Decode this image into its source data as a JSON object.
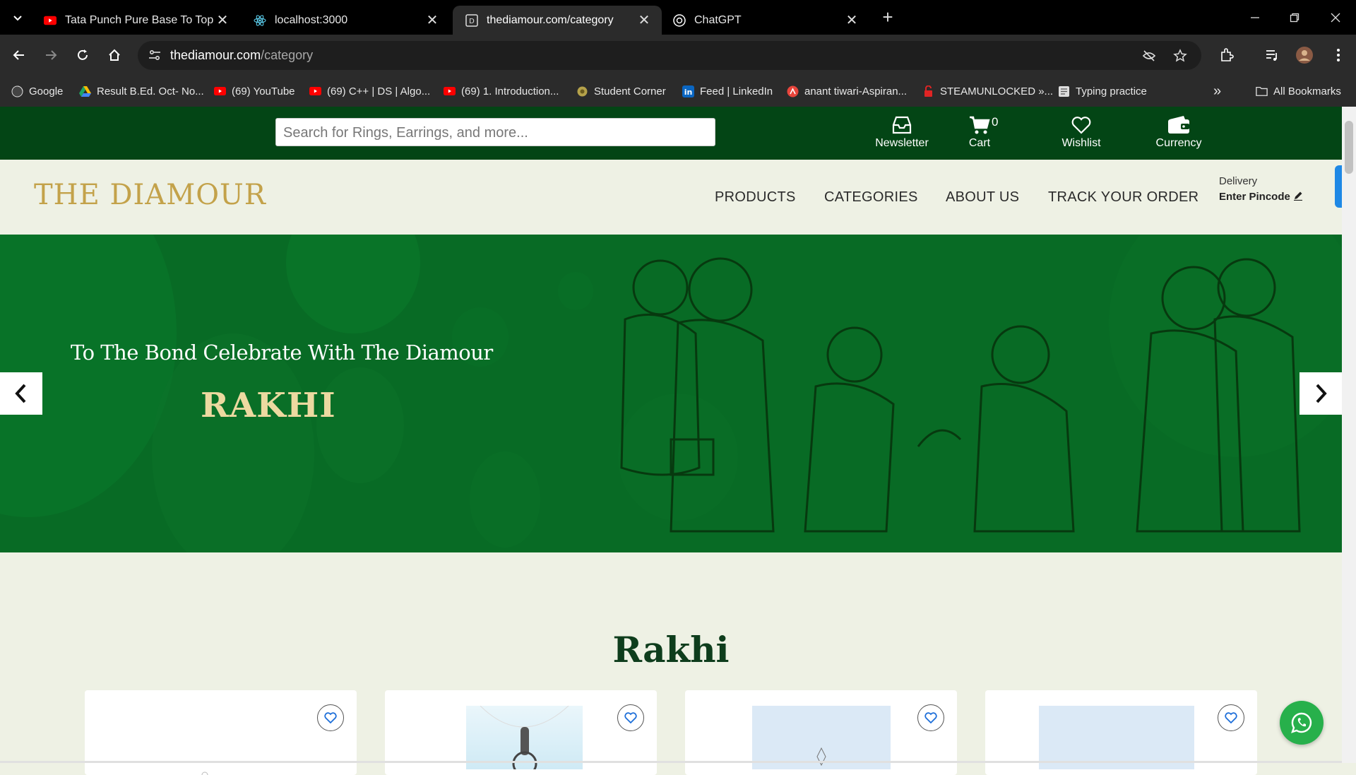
{
  "browser": {
    "tabs": [
      {
        "title": "Tata Punch Pure Base To Top Model",
        "favicon": "youtube-icon",
        "active": false
      },
      {
        "title": "localhost:3000",
        "favicon": "react-icon",
        "active": false
      },
      {
        "title": "thediamour.com/category",
        "favicon": "site-icon",
        "active": true
      },
      {
        "title": "ChatGPT",
        "favicon": "chatgpt-icon",
        "active": false
      }
    ],
    "url_domain": "thediamour.com",
    "url_path": "/category",
    "bookmarks": [
      {
        "label": "Google",
        "icon": "google-icon"
      },
      {
        "label": "Result B.Ed. Oct- No...",
        "icon": "drive-icon"
      },
      {
        "label": "(69) YouTube",
        "icon": "youtube-icon"
      },
      {
        "label": "(69) C++ | DS | Algo...",
        "icon": "youtube-icon"
      },
      {
        "label": "(69) 1. Introduction...",
        "icon": "youtube-icon"
      },
      {
        "label": "Student Corner",
        "icon": "student-icon"
      },
      {
        "label": "Feed | LinkedIn",
        "icon": "linkedin-icon"
      },
      {
        "label": "anant tiwari-Aspiran...",
        "icon": "profile-icon"
      },
      {
        "label": "STEAMUNLOCKED »...",
        "icon": "steam-icon"
      },
      {
        "label": "Typing practice",
        "icon": "typing-icon"
      }
    ],
    "all_bookmarks": "All Bookmarks",
    "more_bookmarks": "»"
  },
  "header": {
    "search_placeholder": "Search for Rings, Earrings, and more...",
    "newsletter": "Newsletter",
    "cart": "Cart",
    "cart_count": "0",
    "wishlist": "Wishlist",
    "currency": "Currency"
  },
  "nav": {
    "logo": "THE DIAMOUR",
    "links": [
      "PRODUCTS",
      "CATEGORIES",
      "ABOUT US",
      "TRACK YOUR ORDER"
    ],
    "delivery_label": "Delivery",
    "pincode_label": "Enter Pincode"
  },
  "hero": {
    "line1": "To The Bond Celebrate With The Diamour",
    "line2": "RAKHI"
  },
  "section": {
    "title": "Rakhi"
  },
  "colors": {
    "brand_green": "#034515",
    "hero_green": "#086b25",
    "gold": "#c3a24a",
    "background": "#eef1e4"
  }
}
